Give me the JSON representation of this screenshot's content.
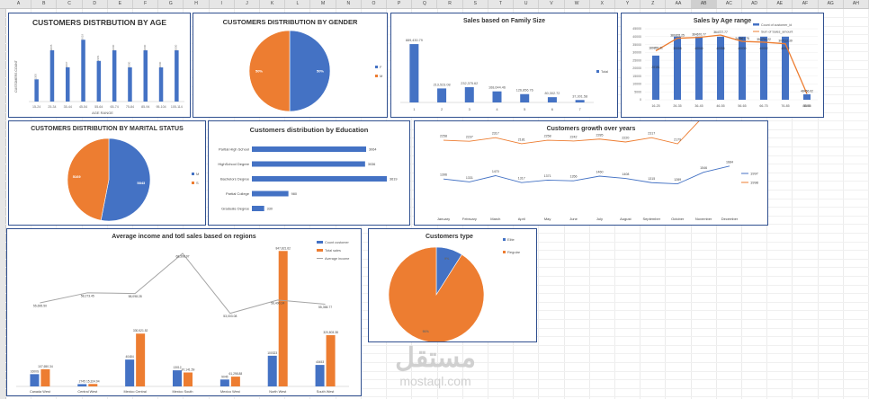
{
  "columns": [
    "A",
    "B",
    "C",
    "D",
    "E",
    "F",
    "G",
    "H",
    "I",
    "J",
    "K",
    "L",
    "M",
    "N",
    "O",
    "P",
    "Q",
    "R",
    "S",
    "T",
    "U",
    "V",
    "W",
    "X",
    "Y",
    "Z",
    "AA",
    "AB",
    "AC",
    "AD",
    "AE",
    "AF",
    "AG",
    "AH"
  ],
  "selected_column": "AB",
  "watermark": {
    "arabic": "مستقل",
    "latin": "mostaql.com"
  },
  "charts": {
    "age": {
      "title": "CUSTOMERS DISTRBUTION BY AGE",
      "ylabel": "CUSTOMERS COUNT",
      "xlabel": "AGE RANGE",
      "chart_data": {
        "type": "bar",
        "categories": [
          "15-24",
          "25-34",
          "35-44",
          "45-54",
          "55-64",
          "65-74",
          "75-84",
          "85-94",
          "95-104",
          "105-114"
        ],
        "values": [
          1300,
          3005,
          2007,
          3619,
          2381,
          3000,
          2000,
          3000,
          2000,
          3000
        ],
        "ylim": [
          0,
          4000
        ],
        "color": "#4472c4"
      }
    },
    "gender": {
      "title": "CUSTOMERS DISTRIBUTION BY GENDER",
      "chart_data": {
        "type": "pie",
        "slices": [
          {
            "name": "F",
            "label": "50%",
            "value": 50,
            "color": "#4472c4"
          },
          {
            "name": "M",
            "label": "50%",
            "value": 50,
            "color": "#ed7d31"
          }
        ]
      }
    },
    "family": {
      "title": "Sales based on Family Size",
      "legend": "Total",
      "chart_data": {
        "type": "bar",
        "categories": [
          "1",
          "2",
          "3",
          "4",
          "5",
          "6",
          "7"
        ],
        "values": [
          889430.79,
          213523.08,
          232375.62,
          168644.46,
          126856.76,
          80302.72,
          37301.58
        ],
        "labels": [
          "889,430.79",
          "213,523.08",
          "232,375.62",
          "168,644.46",
          "126,856.76",
          "80,302.72",
          "37,301.58"
        ],
        "ylim": [
          0,
          1000000
        ],
        "color": "#4472c4"
      }
    },
    "agerange": {
      "title": "Sales by Age range",
      "legend": [
        "Count of customer_id",
        "Sum of Sales_amount"
      ],
      "yticks": [
        "45000",
        "40000",
        "35000",
        "30000",
        "25000",
        "20000",
        "15000",
        "10000",
        "5000",
        "0"
      ],
      "chart_data": {
        "type": "bar",
        "categories": [
          "16-25",
          "26-35",
          "36-45",
          "46-55",
          "56-65",
          "66-75",
          "76-85",
          "86-95"
        ],
        "series": [
          {
            "name": "Count of customer_id",
            "values": [
              28000,
              40000,
              40000,
              40000,
              40000,
              40000,
              40000,
              3500
            ],
            "labels": [
              "20151",
              "30008",
              "40040",
              "40058",
              "40030",
              "40002",
              "40032",
              "3500"
            ],
            "color": "#4472c4"
          },
          {
            "name": "Sum of Sales_amount",
            "values": [
              31000,
              39000,
              39500,
              41000,
              37000,
              36500,
              35500,
              3800
            ],
            "labels": [
              "189855.31",
              "380205.25",
              "364670.77",
              "364727.77",
              "244661.75",
              "354794.22",
              "307112.39",
              "48456.02"
            ],
            "color": "#ed7d31"
          }
        ],
        "ylim": [
          0,
          45000
        ]
      }
    },
    "marital": {
      "title": "CUSTOMERS DISTRIBUTION BY MARITAL STATUS",
      "chart_data": {
        "type": "pie",
        "slices": [
          {
            "name": "M",
            "label": "5843",
            "value": 5843,
            "color": "#4472c4"
          },
          {
            "name": "S",
            "label": "5169",
            "value": 5169,
            "color": "#ed7d31"
          }
        ]
      }
    },
    "education": {
      "title": "Customers distribution by Education",
      "chart_data": {
        "type": "bar",
        "orientation": "horizontal",
        "categories": [
          "Partial High School",
          "HighSchool Degree",
          "Bachelors Degree",
          "Partial College",
          "Graduate Degree"
        ],
        "values": [
          3064,
          3036,
          3619,
          980,
          330
        ],
        "labels": [
          "3064",
          "3036",
          "3619",
          "980",
          "330"
        ],
        "color": "#4472c4"
      }
    },
    "growth": {
      "title": "Customers growth over years",
      "chart_data": {
        "type": "line",
        "categories": [
          "January",
          "February",
          "March",
          "April",
          "May",
          "June",
          "July",
          "August",
          "September",
          "October",
          "November",
          "December"
        ],
        "series": [
          {
            "name": "1997",
            "values": [
              1396,
              1331,
              1470,
              1317,
              1371,
              1356,
              1460,
              1408,
              1315,
              1289,
              1546,
              1684
            ],
            "color": "#4472c4"
          },
          {
            "name": "1998",
            "values": [
              2258,
              2237,
              2317,
              2181,
              2258,
              2242,
              2285,
              2220,
              2317,
              2179,
              2793,
              2689
            ],
            "color": "#ed7d31"
          }
        ]
      }
    },
    "regions": {
      "title": "Average income and totl sales based on regions",
      "legend": [
        "Count customer",
        "Total sales",
        "Average income"
      ],
      "chart_data": {
        "type": "bar",
        "categories": [
          "Canada West",
          "Central West",
          "Mexico Central",
          "Mexico South",
          "Mexico West",
          "North West",
          "South West"
        ],
        "series": [
          {
            "name": "Count customer",
            "values": [
              1600,
              300,
              3500,
              2100,
              900,
              4000,
              2800
            ],
            "labels": [
              "1600S",
              "2745",
              "40484",
              "13012",
              "9045",
              "100323",
              "40453"
            ],
            "color": "#4472c4"
          },
          {
            "name": "Total sales",
            "values": [
              107650,
              15324,
              330521,
              87141,
              61298,
              847821,
              320803
            ],
            "labels": [
              "107,650.34",
              "15,324.94",
              "330,521.52",
              "87,141.59",
              "61,298.88",
              "847,821.62",
              "320,803.38"
            ],
            "color": "#ed7d31"
          },
          {
            "name": "Average income",
            "values": [
              55695.5,
              58273.45,
              58098.28,
              68398.97,
              53003.08,
              56400.24,
              55358.77
            ],
            "labels": [
              "55,695.50",
              "58,273.45",
              "58,098.28",
              "68,398.97",
              "53,003.08",
              "56,400.24",
              "55,358.77"
            ],
            "color": "#a5a5a5"
          }
        ]
      }
    },
    "ctype": {
      "title": "Customers type",
      "chart_data": {
        "type": "pie",
        "slices": [
          {
            "name": "Elite",
            "label": "9%",
            "value": 9,
            "color": "#4472c4"
          },
          {
            "name": "Regular",
            "label": "91%",
            "value": 91,
            "color": "#ed7d31"
          }
        ]
      }
    }
  }
}
